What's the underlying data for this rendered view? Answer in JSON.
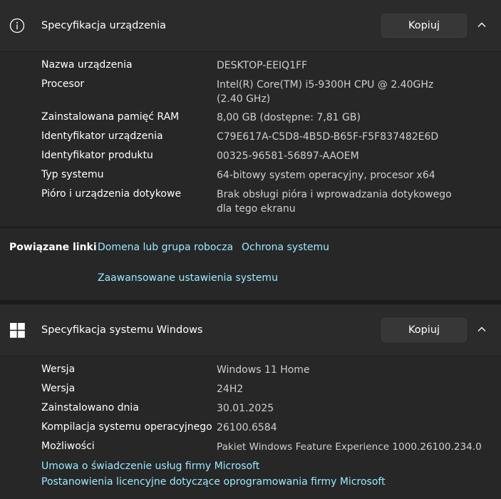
{
  "device_specs": {
    "title": "Specyfikacja urządzenia",
    "copy_label": "Kopiuj",
    "rows": [
      {
        "label": "Nazwa urządzenia",
        "value": "DESKTOP-EEIQ1FF"
      },
      {
        "label": "Procesor",
        "value": "Intel(R) Core(TM) i5-9300H CPU @ 2.40GHz (2.40 GHz)"
      },
      {
        "label": "Zainstalowana pamięć RAM",
        "value": "8,00 GB (dostępne: 7,81 GB)"
      },
      {
        "label": "Identyfikator urządzenia",
        "value": "C79E617A-C5D8-4B5D-B65F-F5F837482E6D"
      },
      {
        "label": "Identyfikator produktu",
        "value": "00325-96581-56897-AAOEM"
      },
      {
        "label": "Typ systemu",
        "value": "64-bitowy system operacyjny, procesor x64"
      },
      {
        "label": "Pióro i urządzenia dotykowe",
        "value": "Brak obsługi pióra i wprowadzania dotykowego dla tego ekranu"
      }
    ]
  },
  "related_links": {
    "label": "Powiązane linki",
    "links": [
      "Domena lub grupa robocza",
      "Ochrona systemu",
      "Zaawansowane ustawienia systemu"
    ]
  },
  "windows_specs": {
    "title": "Specyfikacja systemu Windows",
    "copy_label": "Kopiuj",
    "rows": [
      {
        "label": "Wersja",
        "value": "Windows 11 Home"
      },
      {
        "label": "Wersja",
        "value": "24H2"
      },
      {
        "label": "Zainstalowano dnia",
        "value": "30.01.2025"
      },
      {
        "label": "Kompilacja systemu operacyjnego",
        "value": "26100.6584"
      },
      {
        "label": "Możliwości",
        "value": "Pakiet Windows Feature Experience 1000.26100.234.0"
      }
    ],
    "links": [
      "Umowa o świadczenie usług firmy Microsoft",
      "Postanowienia licencyjne dotyczące oprogramowania firmy Microsoft"
    ]
  },
  "colors": {
    "background": "#1c1c1c",
    "header": "#2b2b2b",
    "panel": "#272727",
    "link": "#99ebff"
  }
}
